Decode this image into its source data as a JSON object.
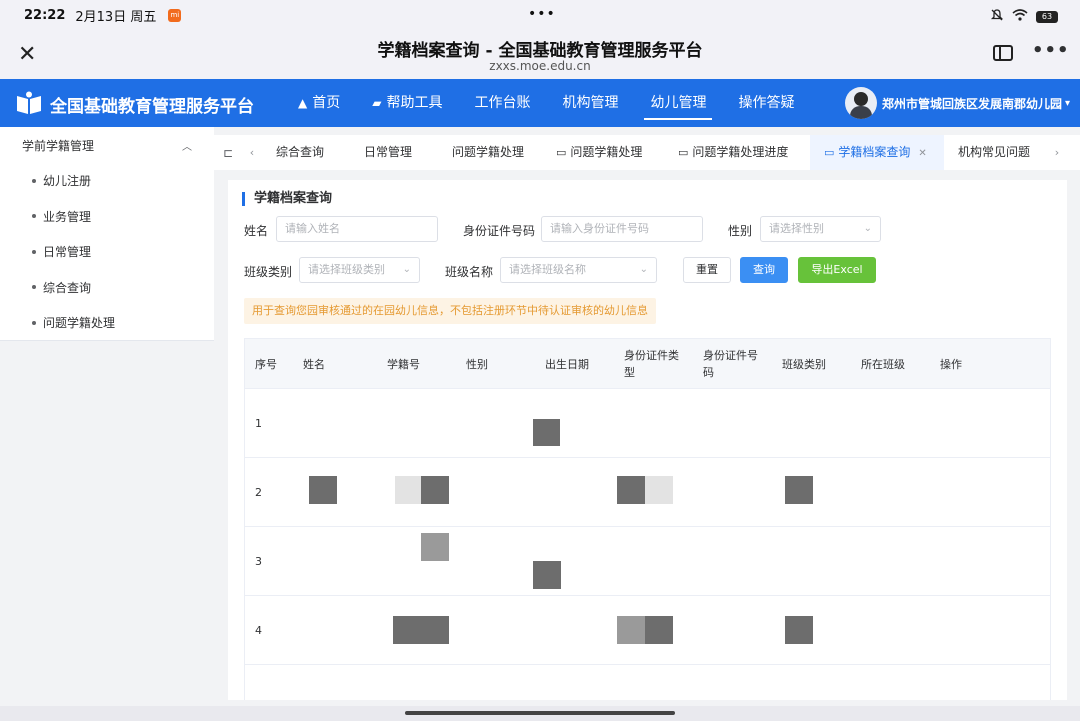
{
  "status_bar": {
    "time": "22:22",
    "date": "2月13日 周五",
    "battery": "63"
  },
  "browser": {
    "title": "学籍档案查询 - 全国基础教育管理服务平台",
    "url": "zxxs.moe.edu.cn"
  },
  "header": {
    "brand": "全国基础教育管理服务平台",
    "nav": [
      {
        "label": "首页"
      },
      {
        "label": "帮助工具"
      },
      {
        "label": "工作台账"
      },
      {
        "label": "机构管理"
      },
      {
        "label": "幼儿管理"
      },
      {
        "label": "操作答疑"
      }
    ],
    "unit_name": "郑州市管城回族区发展南郡幼儿园"
  },
  "sidebar": {
    "group": "学前学籍管理",
    "items": [
      {
        "label": "幼儿注册"
      },
      {
        "label": "业务管理"
      },
      {
        "label": "日常管理"
      },
      {
        "label": "综合查询"
      },
      {
        "label": "问题学籍处理"
      }
    ]
  },
  "tabs": [
    {
      "label": "综合查询"
    },
    {
      "label": "日常管理"
    },
    {
      "label": "问题学籍处理"
    },
    {
      "label": "问题学籍处理"
    },
    {
      "label": "问题学籍处理进度"
    },
    {
      "label": "学籍档案查询"
    },
    {
      "label": "机构常见问题"
    }
  ],
  "panel": {
    "title": "学籍档案查询",
    "form": {
      "name_label": "姓名",
      "name_placeholder": "请输入姓名",
      "id_label": "身份证件号码",
      "id_placeholder": "请输入身份证件号码",
      "gender_label": "性别",
      "gender_placeholder": "请选择性别",
      "class_type_label": "班级类别",
      "class_type_placeholder": "请选择班级类别",
      "class_name_label": "班级名称",
      "class_name_placeholder": "请选择班级名称"
    },
    "buttons": {
      "reset": "重置",
      "query": "查询",
      "export": "导出Excel"
    },
    "notice": "用于查询您园审核通过的在园幼儿信息，不包括注册环节中待认证审核的幼儿信息",
    "table": {
      "headers": [
        "序号",
        "姓名",
        "学籍号",
        "性别",
        "出生日期",
        "身份证件类型",
        "身份证件号码",
        "班级类别",
        "所在班级",
        "操作"
      ],
      "rows": [
        {
          "index": "1"
        },
        {
          "index": "2"
        },
        {
          "index": "3"
        },
        {
          "index": "4"
        }
      ]
    }
  }
}
